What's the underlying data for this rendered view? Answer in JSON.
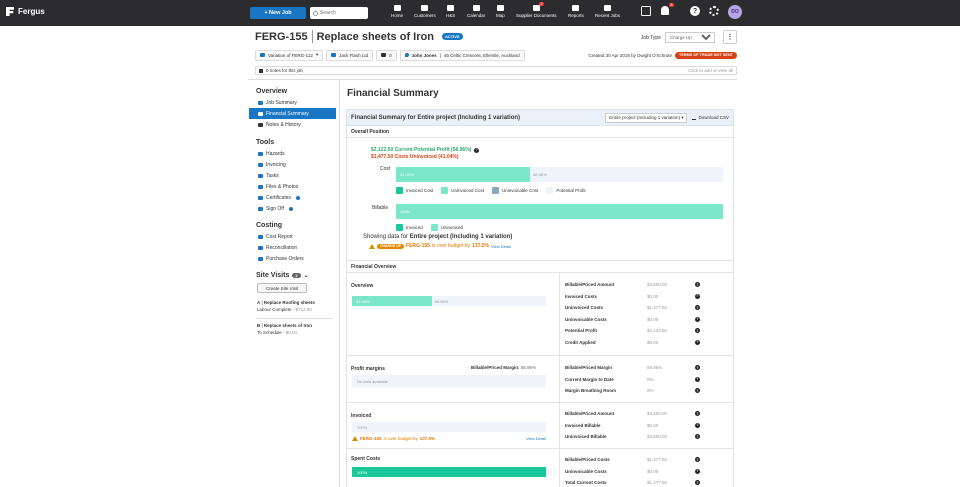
{
  "nav": {
    "brand": "Fergus",
    "new_job": "+ New Job",
    "search_placeholder": "Search",
    "items": [
      {
        "label": "Home",
        "icon": "home-icon"
      },
      {
        "label": "Customers",
        "icon": "customers-icon"
      },
      {
        "label": "H&S",
        "icon": "hs-icon"
      },
      {
        "label": "Calendar",
        "icon": "calendar-icon"
      },
      {
        "label": "Map",
        "icon": "map-icon"
      },
      {
        "label": "Supplier Documents",
        "icon": "supplier-documents-icon",
        "badge": "1"
      },
      {
        "label": "Reports",
        "icon": "reports-icon"
      },
      {
        "label": "Recent Jobs",
        "icon": "recent-jobs-icon"
      }
    ],
    "bell_badge": "5",
    "avatar": "DO"
  },
  "header": {
    "job_number": "FERG-155",
    "job_name": "Replace sheets of Iron",
    "status": "ACTIVE",
    "job_type_label": "Job Type",
    "job_type_value": "Charge Up",
    "variation": "Variation of FERG-112",
    "customer": "Jack Flash Ltd",
    "doc_count": "0",
    "site": "John Jones",
    "site_address": "45 Celtic Crescent, Ellerslie, Auckland",
    "created": "Created 30 Apr 2019 by Dwight O'Schrute",
    "terms_badge": "TERMS OF TRADE NOT SENT",
    "notes": "0 notes for this job",
    "notes_hint": "Click to add or view all"
  },
  "sidebar": {
    "overview_heading": "Overview",
    "overview_items": [
      "Job Summary",
      "Financial Summary",
      "Notes & History"
    ],
    "tools_heading": "Tools",
    "tools_items": [
      "Hazards",
      "Invoicing",
      "Tasks",
      "Files & Photos",
      "Certificates",
      "Sign Off"
    ],
    "costing_heading": "Costing",
    "costing_items": [
      "Cost Report",
      "Reconciliation",
      "Purchase Orders"
    ],
    "site_visits_heading": "Site Visits",
    "site_visits_count": "2",
    "create_site_visit": "Create Site Visit",
    "visits": [
      {
        "letter": "A",
        "name": "Replace Roofing sheets",
        "status": "Labour Complete",
        "amount": "$712.50"
      },
      {
        "letter": "B",
        "name": "Replace sheets of Iron",
        "status": "To Schedule",
        "amount": "$0.00"
      }
    ]
  },
  "main": {
    "title": "Financial Summary",
    "panel_title": "Financial Summary for Entire project (Including 1 variation)",
    "scope_select": "Entire project (Including 1 variation)",
    "download": "Download CSV",
    "overall_position": "Overall Position",
    "profit_line": "$2,122.50 Current Potential Profit (58.96%)",
    "costs_line": "$1,477.50 Costs Uninvoiced (41.04%)",
    "cost_label": "Cost",
    "cost_fill_label": "41.04%",
    "cost_rest_label": "58.96%",
    "cost_legend": [
      "Invoiced Cost",
      "Uninvoiced Cost",
      "Uninvoicable Cost",
      "Potential Profit"
    ],
    "billable_label": "Billable",
    "billable_fill_label": "100%",
    "billable_legend": [
      "Invoiced",
      "Uninvoiced"
    ],
    "showing_prefix": "Showing data for",
    "showing_bold": "Entire project (Including 1 variation)",
    "warn_badge": "CHARGE UP",
    "warn_job": "FERG-155",
    "warn_text": "is over budget by",
    "warn_pct": "137.5%",
    "view_detail": "View Detail",
    "financial_overview": "Financial Overview",
    "overview": {
      "title": "Overview",
      "fill_label": "41.04%",
      "rest_label": "58.96%",
      "rows": [
        {
          "k": "Billable/Priced Amount",
          "v": "$3,600.00"
        },
        {
          "k": "Invoiced Costs",
          "v": "$0.00"
        },
        {
          "k": "Uninvoiced Costs",
          "v": "$1,477.50"
        },
        {
          "k": "Uninvoicable Costs",
          "v": "$0.00"
        },
        {
          "k": "Potential Profit",
          "v": "$2,122.50"
        },
        {
          "k": "Credit Applied",
          "v": "$0.00"
        }
      ]
    },
    "margins": {
      "title": "Profit margins",
      "right_label": "Billable/Priced Margin:",
      "right_value": "58.96%",
      "no_data": "No data available",
      "rows": [
        {
          "k": "Billable/Priced Margin",
          "v": "58.96%"
        },
        {
          "k": "Current Margin to Date",
          "v": "0%"
        },
        {
          "k": "Margin Breathing Room",
          "v": "0%"
        }
      ]
    },
    "invoiced": {
      "title": "Invoiced",
      "bar_label": "100%",
      "warn_job": "FERG-155",
      "warn_text": "is over budget by",
      "warn_pct": "137.5%",
      "view_detail": "View Detail",
      "rows": [
        {
          "k": "Billable/Priced Amount",
          "v": "$3,600.00"
        },
        {
          "k": "Invoiced Billable",
          "v": "$0.00"
        },
        {
          "k": "Uninvoiced Billable",
          "v": "$3,600.00"
        }
      ]
    },
    "spent": {
      "title": "Spent Costs",
      "bar_label": "100%",
      "rows": [
        {
          "k": "Billable/Priced Costs",
          "v": "$1,477.50"
        },
        {
          "k": "Uninvoicable Costs",
          "v": "$0.00"
        },
        {
          "k": "Total Current Costs",
          "v": "$1,477.50"
        }
      ]
    }
  },
  "colors": {
    "accent": "#1976c5",
    "green": "#7be6c8",
    "dark_green": "#19c99b",
    "warn": "#e08a00"
  }
}
